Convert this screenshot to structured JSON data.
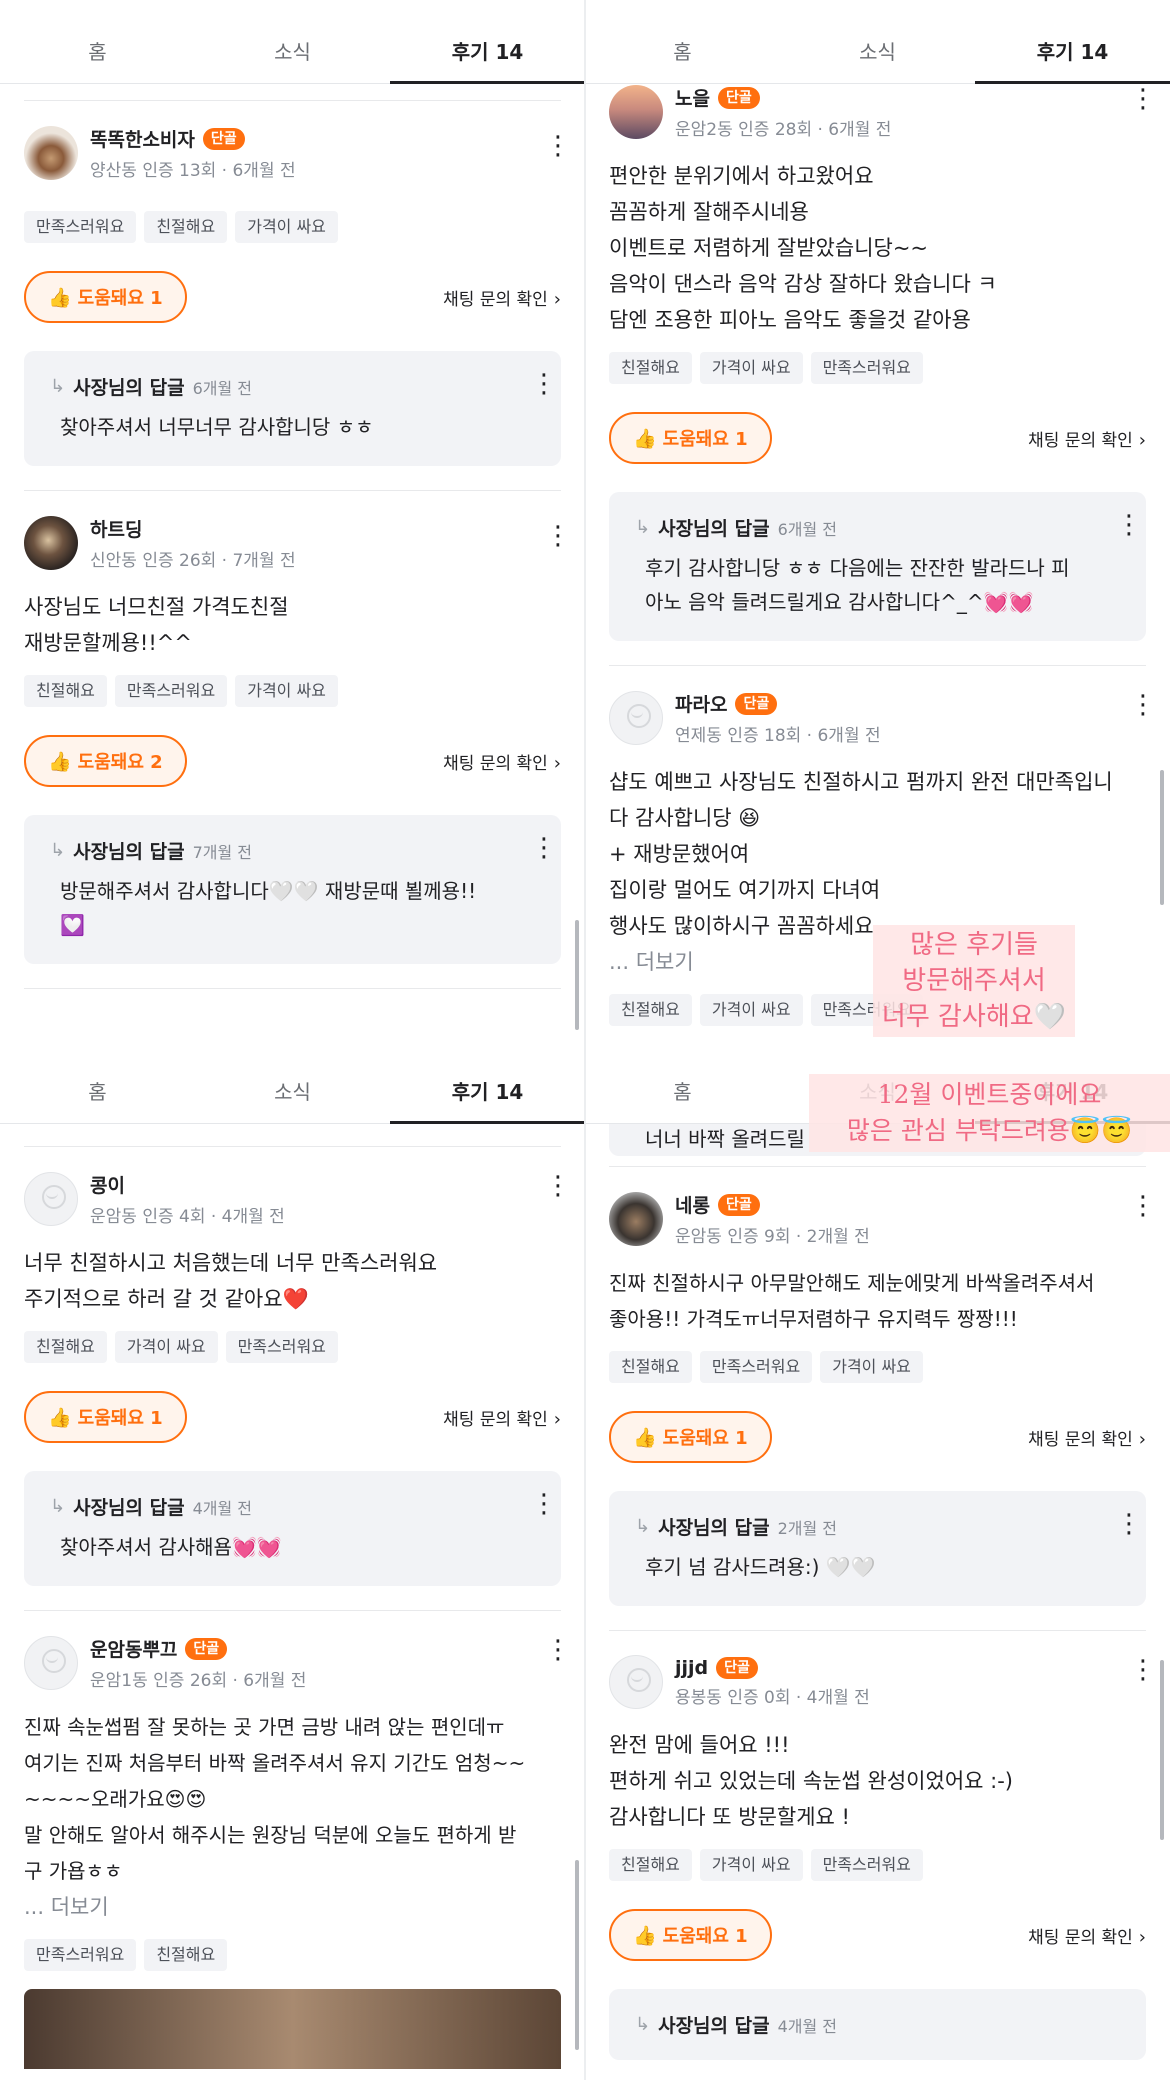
{
  "tabs": {
    "home": "홈",
    "news": "소식",
    "reviews": "후기 14"
  },
  "common": {
    "badge": "단골",
    "chat_link": "채팅 문의 확인",
    "reply_title": "사장님의 답글",
    "more": "... 더보기"
  },
  "q1": {
    "r1": {
      "name": "똑똑한소비자",
      "meta": "양산동 인증 13회 · 6개월 전",
      "tags": [
        "만족스러워요",
        "친절해요",
        "가격이 싸요"
      ],
      "helpful": "도움돼요 1",
      "reply_time": "6개월 전",
      "reply_text": "찾아주셔서 너무너무 감사합니당 ㅎㅎ"
    },
    "r2": {
      "name": "하트딩",
      "meta": "신안동 인증 26회 · 7개월 전",
      "body": "사장님도 너므친절 가격도친절\n재방문할께용!!^^",
      "tags": [
        "친절해요",
        "만족스러워요",
        "가격이 싸요"
      ],
      "helpful": "도움돼요 2",
      "reply_time": "7개월 전",
      "reply_text": "방문해주셔서 감사합니다🤍🤍 재방문때 뵐께용!!\n💟"
    }
  },
  "q2": {
    "r1": {
      "name": "노을",
      "meta": "운암2동 인증 28회 · 6개월 전",
      "body": "편안한 분위기에서 하고왔어요\n꼼꼼하게 잘해주시네용\n이벤트로 저렴하게 잘받았습니당~~\n음악이 댄스라 음악 감상 잘하다 왔습니다 ㅋ\n담엔 조용한 피아노 음악도 좋을것 같아용",
      "tags": [
        "친절해요",
        "가격이 싸요",
        "만족스러워요"
      ],
      "helpful": "도움돼요 1",
      "reply_time": "6개월 전",
      "reply_text": "후기 감사합니당 ㅎㅎ 다음에는 잔잔한 발라드나 피\n아노 음악 들려드릴게요 감사합니다^_^💓💓"
    },
    "r2": {
      "name": "파라오",
      "meta": "연제동 인증 18회 · 6개월 전",
      "body": "샵도 예쁘고 사장님도 친절하시고 펌까지 완전 대만족입니\n다 감사합니당 😆\n+ 재방문했어여\n집이랑 멀어도 여기까지 다녀여\n행사도 많이하시구 꼼꼼하세요",
      "tags": [
        "친절해요",
        "가격이 싸요",
        "만족스러워요"
      ]
    },
    "overlay": "많은 후기들\n방문해주셔서\n너무 감사해요🤍"
  },
  "q3": {
    "r1": {
      "name": "콩이",
      "meta": "운암동 인증 4회 · 4개월 전",
      "body": "너무 친절하시고 처음했는데 너무 만족스러워요\n주기적으로 하러 갈 것 같아요❤️",
      "tags": [
        "친절해요",
        "가격이 싸요",
        "만족스러워요"
      ],
      "helpful": "도움돼요 1",
      "reply_time": "4개월 전",
      "reply_text": "찾아주셔서 감사해욤💓💓"
    },
    "r2": {
      "name": "운암동뿌끄",
      "meta": "운암1동 인증 26회 · 6개월 전",
      "body": "진짜 속눈썹펌 잘 못하는 곳 가면 금방 내려 앉는 편인데ㅠ\n여기는 진짜 처음부터 바짝 올려주셔서 유지 기간도 엄청~~\n~~~~오래가요😍😍\n말 안해도 알아서 해주시는 원장님 덕분에 오늘도 편하게 받\n구 가욥ㅎㅎ",
      "tags": [
        "만족스러워요",
        "친절해요"
      ]
    }
  },
  "q4": {
    "overlay": "12월 이벤트중이에요\n많은 관심 부탁드려용😇😇",
    "partial": "너너 바짝 올려드릴",
    "r1": {
      "name": "네롱",
      "meta": "운암동 인증 9회 · 2개월 전",
      "body": "진짜 친절하시구 아무말안해도 제눈에맞게 바싹올려주셔서\n좋아용!! 가격도ㅠ너무저렴하구 유지력두 짱짱!!!",
      "tags": [
        "친절해요",
        "만족스러워요",
        "가격이 싸요"
      ],
      "helpful": "도움돼요 1",
      "reply_time": "2개월 전",
      "reply_text": "후기 넘 감사드려용:) 🤍🤍"
    },
    "r2": {
      "name": "jjjd",
      "meta": "용봉동 인증 0회 · 4개월 전",
      "body": "완전 맘에 들어요 !!!\n편하게 쉬고 있었는데 속눈썹 완성이었어요 :-)\n감사합니다 또 방문할게요 !",
      "tags": [
        "친절해요",
        "가격이 싸요",
        "만족스러워요"
      ],
      "helpful": "도움돼요 1",
      "reply_time": "4개월 전"
    }
  }
}
